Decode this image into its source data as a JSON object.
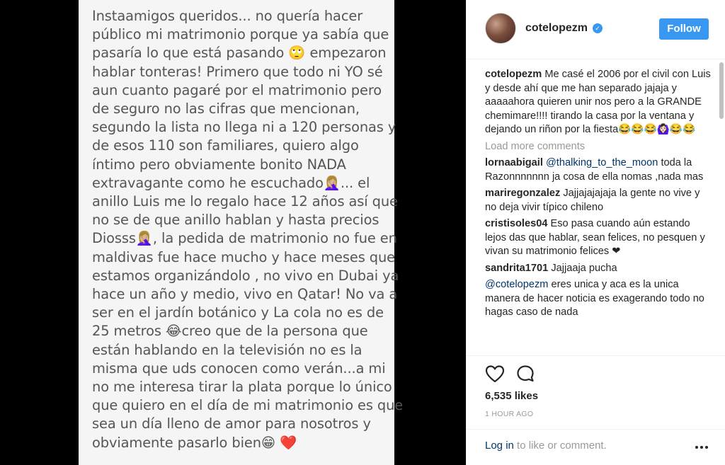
{
  "photo": {
    "lines": [
      "Instaamigos queridos... no quería hacer",
      "público mi matrimonio porque ya sabía que",
      "pasaría lo que está pasando 🙄 empezaron",
      "hablar tonteras! Primero que todo ni YO sé",
      "aun cuanto pagaré por el matrimonio pero",
      "de seguro no las cifras que mencionan,",
      "segundo la lista no llega ni a 120 personas y",
      "de esos 110 son familiares, quiero algo",
      "íntimo pero obviamente bonito NADA",
      "extravagante como he escuchado🤦🏼‍♀️... el",
      "anillo Luis me lo regalo hace 12 años así que",
      "no se de que anillo hablan y hasta precios",
      "Diosss🤦🏼‍♀️, la pedida de matrimonio no fue en",
      "maldivas fue hace mucho y hace meses que",
      "estamos organizándolo , no vivo en Dubai ya",
      "hace un año y medio, vivo en Qatar! No va a",
      "ser en el jardín botánico y La cola no es de",
      "25 metros 😂creo que de la persona que",
      "están hablando en la televisión no es la",
      "misma que uds conocen como verán...a mi",
      "no me interesa tirar la plata porque lo único",
      "que quiero en el día de mi matrimonio es que",
      "sea un día lleno de amor para nosotros y",
      "obviamente pasarlo bien😁 ❤️"
    ]
  },
  "header": {
    "username": "cotelopezm",
    "verified_glyph": "✓",
    "follow_label": "Follow"
  },
  "caption": {
    "username": "cotelopezm",
    "text": "Me casé el 2006 por el civil con Luis y desde ahí que me han separado jajaja y aaaaahora quieren unir nos pero a la GRANDE chemimare!!!! tirando la casa por la ventana y dejando un riñon por la fiesta😂😂😂🙆🏻‍♀️😂😂"
  },
  "load_more": "Load more comments",
  "comments": [
    {
      "username": "lornaabigail",
      "mention": "@thalking_to_the_moon",
      "text": "toda la Razonnnnnnn ja cosa de ella nomas ,nada mas"
    },
    {
      "username": "mariregonzalez",
      "mention": "",
      "text": "Jajjajajajaja la gente no vive y no deja vivir típico chileno"
    },
    {
      "username": "cristisoles04",
      "mention": "",
      "text": "Eso pasa cuando aún estando lejos das que hablar, sean felices, no pesquen y vivan su matrimonio felices ❤"
    },
    {
      "username": "sandrita1701",
      "mention": "",
      "text": "Jajjaaja pucha"
    },
    {
      "username": "",
      "mention": "@cotelopezm",
      "text": "eres unica y aca es la unica manera de hacer noticia es exagerando todo no hagas caso de nada"
    }
  ],
  "likes": "6,535 likes",
  "time": "1 HOUR AGO",
  "footer": {
    "login_link": "Log in",
    "login_rest": " to like or comment."
  },
  "icons": {
    "like": "heart-icon",
    "comment": "comment-bubble-icon",
    "more": "more-options-icon",
    "verified": "verified-badge-icon"
  },
  "colors": {
    "accent": "#3897f0",
    "link": "#003569",
    "muted": "#999999",
    "text": "#262626"
  }
}
